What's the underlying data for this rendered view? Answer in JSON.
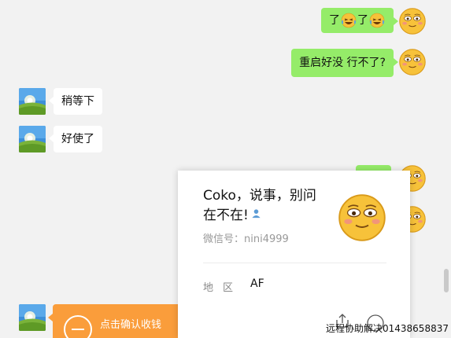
{
  "messages": [
    {
      "side": "me",
      "text_before": "了",
      "text_middle": "了",
      "emoji": "laughing-tears-emoji"
    },
    {
      "side": "me",
      "text": "重启好没  行不了?"
    },
    {
      "side": "them",
      "text": "稍等下"
    },
    {
      "side": "them",
      "text": "好使了"
    }
  ],
  "transfer": {
    "label": "点击确认收钱",
    "icon": "transfer-icon"
  },
  "profile_card": {
    "name": "Coko，说事，别问在不在!",
    "wxid": "微信号：nini4999",
    "region_label": "地区",
    "region_value": "AF"
  },
  "watermark": "远程协助解决01438658837",
  "colors": {
    "my_bubble": "#95ec69",
    "their_bubble": "#ffffff",
    "transfer": "#fa9d3b",
    "background": "#f2f2f2"
  }
}
